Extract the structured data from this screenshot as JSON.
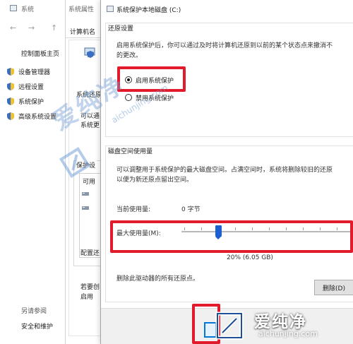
{
  "system_window": {
    "title": "系统",
    "nav": {
      "back": "←",
      "forward": "→",
      "up": "↑"
    },
    "control_panel_home": "控制面板主页",
    "links": [
      {
        "label": "设备管理器"
      },
      {
        "label": "远程设置"
      },
      {
        "label": "系统保护"
      },
      {
        "label": "高级系统设置"
      }
    ],
    "see_also": "另请参阅",
    "security_maintenance": "安全和维护"
  },
  "properties_window": {
    "title": "系统属性",
    "tab": "计算机名",
    "texts": [
      "系统还原",
      "可以通",
      "系统更",
      "保护设",
      "可用",
      "配置还",
      "若要创",
      "启用"
    ]
  },
  "dialog": {
    "title": "系统保护本地磁盘 (C:)",
    "restore_settings": {
      "heading": "还原设置",
      "description_line1": "启用系统保护后，你可以通过及时将计算机还原到以前的某个状态点来撤消不",
      "description_line2": "的更改。",
      "option_enable": "启用系统保护",
      "option_disable": "禁用系统保护",
      "selected": "enable"
    },
    "disk_usage": {
      "heading": "磁盘空间使用量",
      "description_line1": "可以调整用于系统保护的最大磁盘空间。占满空间时，系统将删除较旧的还原",
      "description_line2": "以便为新还原点留出空间。",
      "current_usage_label": "当前使用量:",
      "current_usage_value": "0 字节",
      "max_usage_label": "最大使用量(M):",
      "max_usage_value": "20% (6.05 GB)",
      "max_usage_fraction": 0.2,
      "delete_description": "删除此驱动器的所有还原点。",
      "delete_button": "删除(D)"
    }
  },
  "watermark": {
    "text": "爱纯净",
    "url": "aichunjing.com"
  },
  "colors": {
    "highlight": "#e11b2b",
    "accent": "#1b5fd0",
    "watermark": "#78a0d2"
  }
}
